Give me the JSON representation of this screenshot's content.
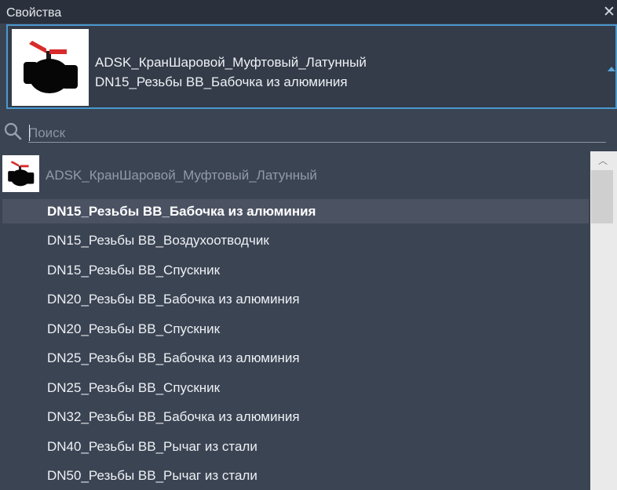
{
  "panel": {
    "title": "Свойства",
    "close_glyph": "✕"
  },
  "selector": {
    "family": "ADSK_КранШаровой_Муфтовый_Латунный",
    "type": "DN15_Резьбы ВВ_Бабочка из алюминия",
    "thumbnail_icon": "ball-valve-icon",
    "dropdown_icon": "dropdown-arrow-icon"
  },
  "search": {
    "placeholder": "Поиск",
    "value": "",
    "icon": "search-icon"
  },
  "list": {
    "family_label": "ADSK_КранШаровой_Муфтовый_Латунный",
    "selected_index": 0,
    "items": [
      "DN15_Резьбы ВВ_Бабочка из алюминия",
      "DN15_Резьбы ВВ_Воздухоотводчик",
      "DN15_Резьбы ВВ_Спускник",
      "DN20_Резьбы ВВ_Бабочка из алюминия",
      "DN20_Резьбы ВВ_Спускник",
      "DN25_Резьбы ВВ_Бабочка из алюминия",
      "DN25_Резьбы ВВ_Спускник",
      "DN32_Резьбы ВВ_Бабочка из алюминия",
      "DN40_Резьбы ВВ_Рычаг из стали",
      "DN50_Резьбы ВВ_Рычаг из стали"
    ]
  },
  "scrollbar": {
    "up_glyph": "︿"
  },
  "colors": {
    "panel_bg": "#3b4453",
    "titlebar_bg": "#2b313c",
    "accent_border": "#4a98cf",
    "selected_row": "#4b5363",
    "text": "#eef1f5",
    "muted_text": "#939aa6"
  }
}
